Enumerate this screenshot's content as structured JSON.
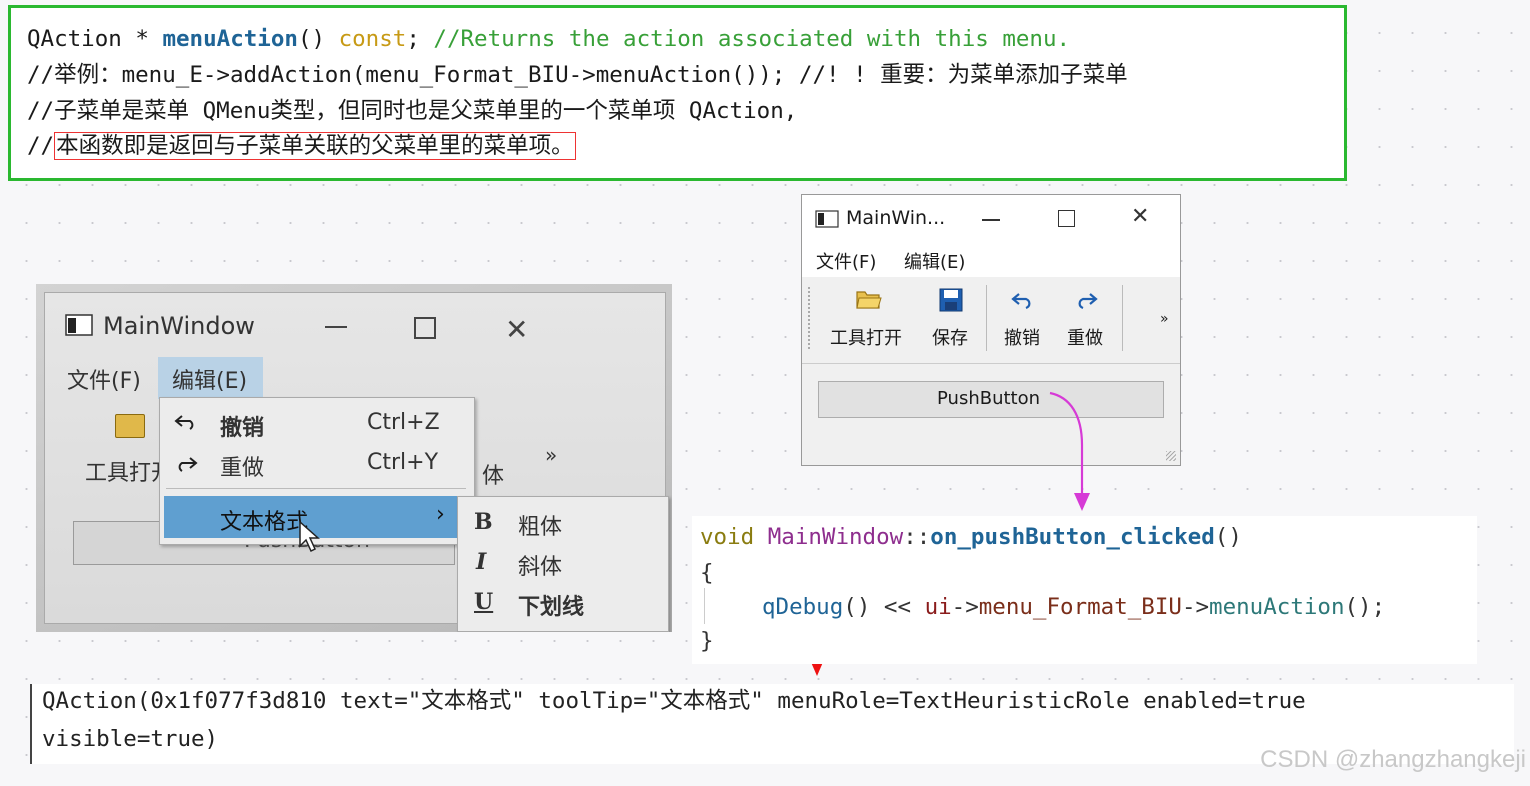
{
  "top_code": {
    "line1": {
      "type": "QAction",
      "op": " * ",
      "fn": "menuAction",
      "paren": "()",
      "kw": " const",
      "semi": "; ",
      "comment": "//Returns the action associated with this menu."
    },
    "line2": "//举例：menu_E->addAction(menu_Format_BIU->menuAction()); //! ! 重要：为菜单添加子菜单",
    "line3": "//子菜单是菜单 QMenu类型，但同时也是父菜单里的一个菜单项 QAction,",
    "line4": {
      "prefix": "//",
      "boxed": "本函数即是返回与子菜单关联的父菜单里的菜单项。"
    }
  },
  "photo_window": {
    "title": "MainWindow",
    "menubar": {
      "file": "文件(F)",
      "edit": "编辑(E)"
    },
    "toolbar_label": "工具打开",
    "toolbar_cut": "体",
    "more": "»",
    "edit_menu": {
      "items": [
        {
          "label": "撤销",
          "shortcut": "Ctrl+Z",
          "icon": "undo-icon"
        },
        {
          "label": "重做",
          "shortcut": "Ctrl+Y",
          "icon": "redo-icon"
        },
        {
          "label": "文本格式",
          "arrow": "›",
          "highlighted": true
        }
      ]
    },
    "format_submenu": {
      "items": [
        {
          "icon_text": "B",
          "label": "粗体"
        },
        {
          "icon_text": "I",
          "label": "斜体"
        },
        {
          "icon_text": "U",
          "label": "下划线"
        }
      ]
    },
    "pushbutton_partial": "PushButton"
  },
  "small_window": {
    "title": "MainWin...",
    "menubar": {
      "file": "文件(F)",
      "edit": "编辑(E)"
    },
    "toolbar": [
      {
        "label": "工具打开",
        "icon": "folder-open-icon"
      },
      {
        "label": "保存",
        "icon": "save-icon"
      },
      {
        "label": "撤销",
        "icon": "undo-icon"
      },
      {
        "label": "重做",
        "icon": "redo-icon"
      }
    ],
    "more": "»",
    "pushbutton": "PushButton"
  },
  "right_code": {
    "l1": {
      "void": "void ",
      "cls": "MainWindow",
      "sep": "::",
      "slot": "on_pushButton_clicked",
      "paren": "()"
    },
    "l2": "{",
    "l3": {
      "fn": "qDebug",
      "a": "() << ",
      "var": "ui",
      "arrow": "->",
      "mem": "menu_Format_BIU",
      "arrow2": "->",
      "mf": "menuAction",
      "end": "();"
    },
    "l4": "}"
  },
  "output": {
    "line1": "QAction(0x1f077f3d810 text=\"文本格式\" toolTip=\"文本格式\" menuRole=TextHeuristicRole enabled=true",
    "line2": "visible=true)"
  },
  "watermark": "CSDN @zhangzhangkeji",
  "colors": {
    "green_frame": "#2ab830",
    "red_box": "#e33333",
    "magenta_arrow": "#d63ad6",
    "red_arrow": "#ee1111"
  }
}
